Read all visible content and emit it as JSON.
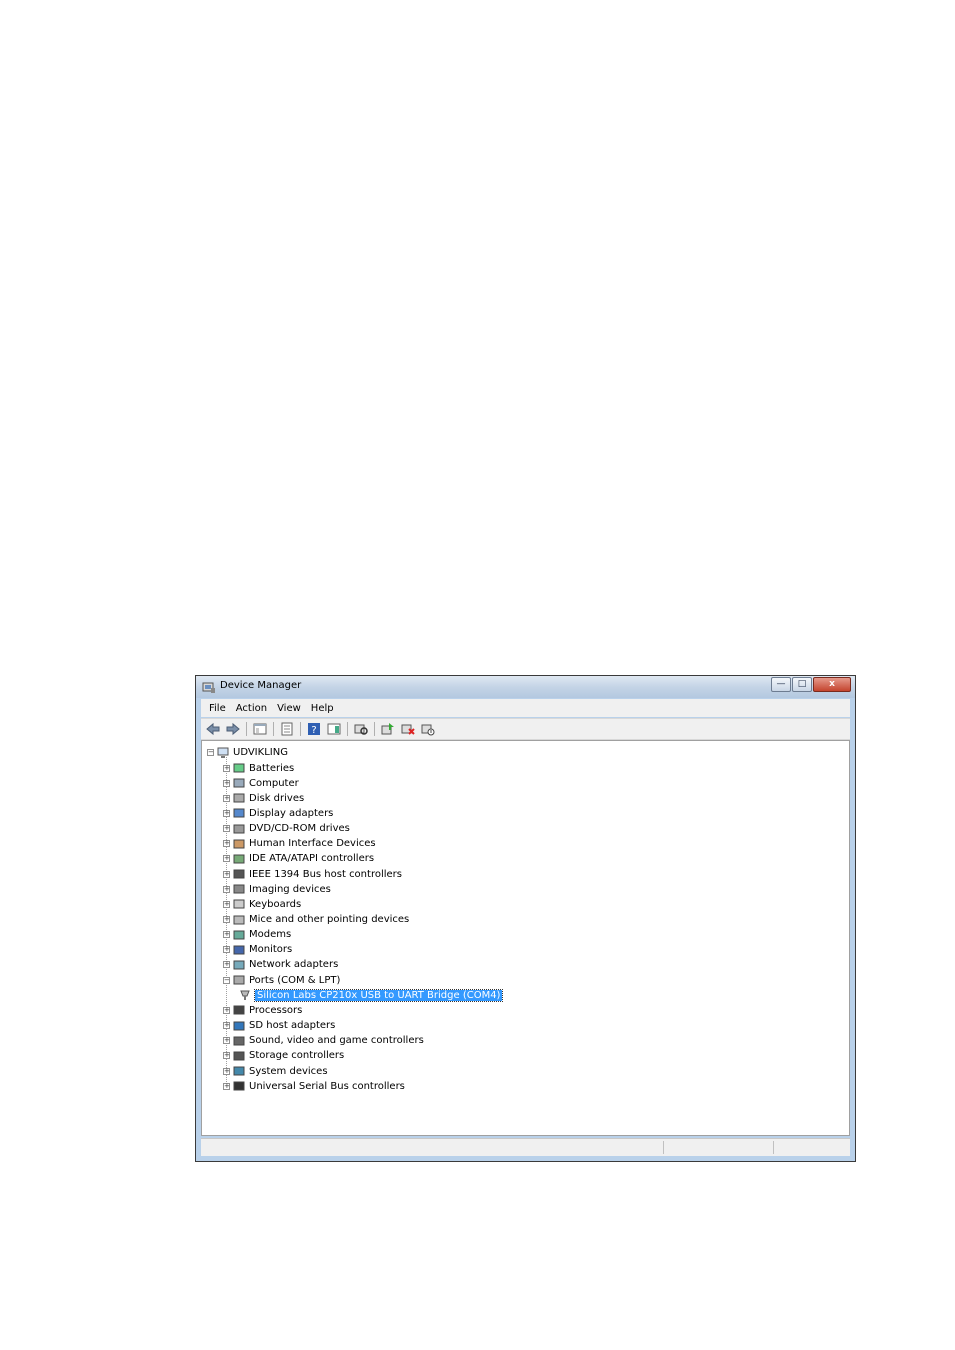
{
  "window": {
    "title": "Device Manager",
    "buttons": {
      "minimize": "—",
      "maximize": "□",
      "close": "x"
    }
  },
  "menu": [
    {
      "label": "File"
    },
    {
      "label": "Action"
    },
    {
      "label": "View"
    },
    {
      "label": "Help"
    }
  ],
  "toolbar": {
    "icons": [
      "back-icon",
      "forward-icon",
      "show-hide-tree-icon",
      "properties-icon",
      "help-icon",
      "action-pane-icon",
      "scan-hardware-icon",
      "update-driver-icon",
      "uninstall-icon",
      "disable-icon"
    ]
  },
  "tree": {
    "root": "UDVIKLING",
    "items": [
      {
        "label": "Batteries",
        "expanded": false
      },
      {
        "label": "Computer",
        "expanded": false
      },
      {
        "label": "Disk drives",
        "expanded": false
      },
      {
        "label": "Display adapters",
        "expanded": false
      },
      {
        "label": "DVD/CD-ROM drives",
        "expanded": false
      },
      {
        "label": "Human Interface Devices",
        "expanded": false
      },
      {
        "label": "IDE ATA/ATAPI controllers",
        "expanded": false
      },
      {
        "label": "IEEE 1394 Bus host controllers",
        "expanded": false
      },
      {
        "label": "Imaging devices",
        "expanded": false
      },
      {
        "label": "Keyboards",
        "expanded": false
      },
      {
        "label": "Mice and other pointing devices",
        "expanded": false
      },
      {
        "label": "Modems",
        "expanded": false
      },
      {
        "label": "Monitors",
        "expanded": false
      },
      {
        "label": "Network adapters",
        "expanded": false
      },
      {
        "label": "Ports (COM & LPT)",
        "expanded": true
      },
      {
        "label": "Processors",
        "expanded": false
      },
      {
        "label": "SD host adapters",
        "expanded": false
      },
      {
        "label": "Sound, video and game controllers",
        "expanded": false
      },
      {
        "label": "Storage controllers",
        "expanded": false
      },
      {
        "label": "System devices",
        "expanded": false
      },
      {
        "label": "Universal Serial Bus controllers",
        "expanded": false
      }
    ],
    "child": "Silicon Labs CP210x USB to UART Bridge (COM4)"
  },
  "colors": {
    "selection": "#3399ff",
    "frame": "#b9d1ea"
  }
}
